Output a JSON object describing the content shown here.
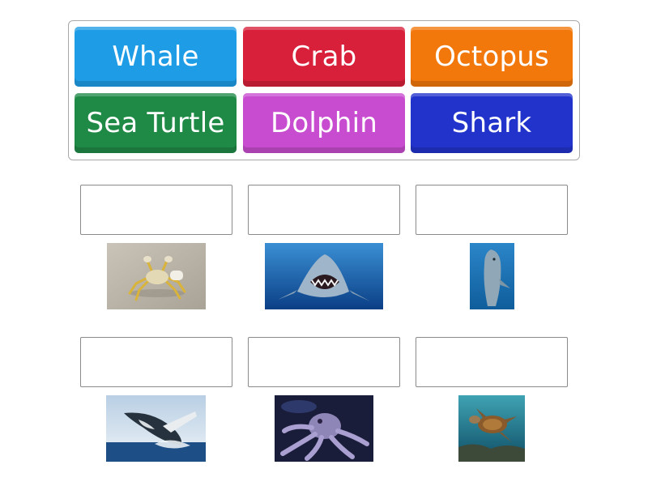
{
  "word_bank": {
    "tiles": [
      {
        "label": "Whale",
        "color": "#1e9de6"
      },
      {
        "label": "Crab",
        "color": "#d8203a"
      },
      {
        "label": "Octopus",
        "color": "#f2780c"
      },
      {
        "label": "Sea Turtle",
        "color": "#1f8a46"
      },
      {
        "label": "Dolphin",
        "color": "#c84ccf"
      },
      {
        "label": "Shark",
        "color": "#2233cc"
      }
    ]
  },
  "drop_targets": [
    {
      "image": "crab-photo",
      "value": ""
    },
    {
      "image": "shark-photo",
      "value": ""
    },
    {
      "image": "dolphin-photo",
      "value": ""
    },
    {
      "image": "whale-photo",
      "value": ""
    },
    {
      "image": "octopus-photo",
      "value": ""
    },
    {
      "image": "sea-turtle-photo",
      "value": ""
    }
  ]
}
